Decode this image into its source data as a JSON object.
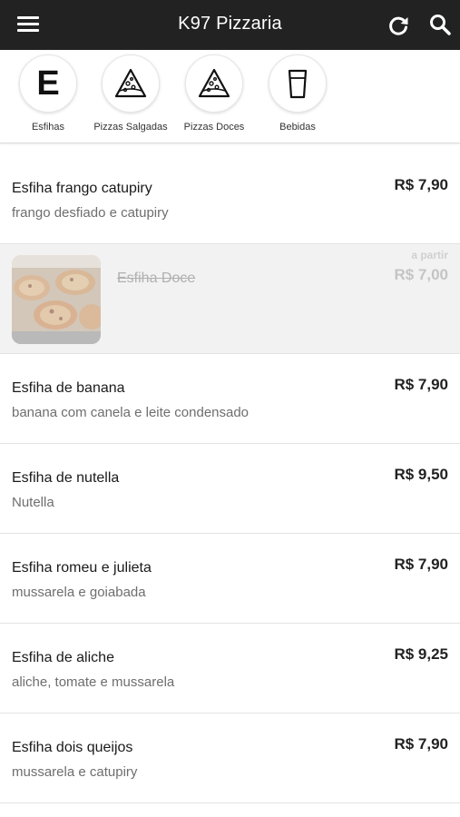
{
  "header": {
    "title": "K97 Pizzaria",
    "menu_icon": "hamburger-menu-icon",
    "refresh_icon": "refresh-icon",
    "search_icon": "search-icon",
    "background": "#222222"
  },
  "categories": [
    {
      "label": "Esfihas",
      "icon": "letter-e-icon",
      "glyph": "E"
    },
    {
      "label": "Pizzas Salgadas",
      "icon": "pizza-slice-icon"
    },
    {
      "label": "Pizzas Doces",
      "icon": "pizza-slice-icon"
    },
    {
      "label": "Bebidas",
      "icon": "drink-glass-icon"
    }
  ],
  "items": [
    {
      "name": "Esfiha frango catupiry",
      "description": "frango desfiado e catupiry",
      "price": "R$ 7,90"
    },
    {
      "name": "Esfiha Doce",
      "price": "R$ 7,00",
      "price_prefix": "a partir",
      "unavailable": true,
      "image": "food-photo-thumbnail"
    },
    {
      "name": "Esfiha de banana",
      "description": "banana com canela e leite condensado",
      "price": "R$ 7,90"
    },
    {
      "name": "Esfiha de nutella",
      "description": "Nutella",
      "price": "R$ 9,50"
    },
    {
      "name": "Esfiha romeu e julieta",
      "description": "mussarela e goiabada",
      "price": "R$ 7,90"
    },
    {
      "name": "Esfiha de aliche",
      "description": "aliche, tomate e mussarela",
      "price": "R$ 9,25"
    },
    {
      "name": "Esfiha dois queijos",
      "description": "mussarela e catupiry",
      "price": "R$ 7,90"
    }
  ]
}
